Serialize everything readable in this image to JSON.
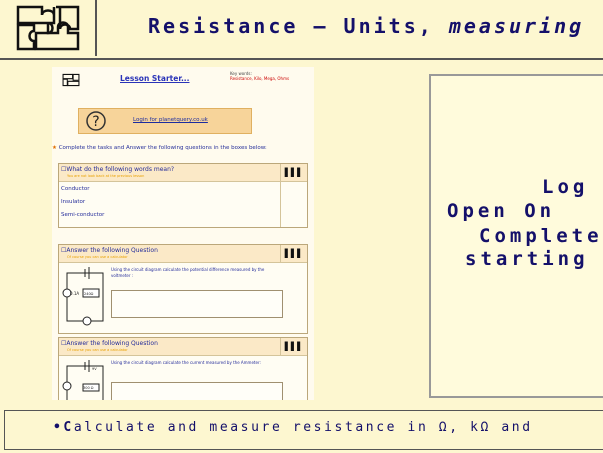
{
  "header": {
    "title_bold": "Resistance – Units, ",
    "title_italic": "measuring"
  },
  "worksheet": {
    "starter_link": "Lesson Starter...",
    "key_words_label": "Key words:",
    "key_words": "Resistance, Kilo, Mega, Ohms",
    "login_link": "Login for planetquery.co.uk",
    "instructions": "Complete the tasks and Answer the following questions in the boxes below:",
    "q1": {
      "title": "What do the following words mean?",
      "subtitle": "You are not look back at the previous lesson",
      "words": [
        "Conductor",
        "Insulator",
        "Semi-conductor"
      ]
    },
    "q2": {
      "title": "Answer the following Question",
      "subtitle": "Of course you can use a calculator",
      "text": "Using the circuit diagram calculate the potential difference measured by the voltmeter :",
      "labels": [
        "0.1A",
        "240Ω"
      ]
    },
    "q3": {
      "title": "Answer the following Question",
      "subtitle": "Of course you can use a calculator",
      "text": "Using the circuit diagram calculate the current measured by the Ammeter:",
      "labels": [
        "9V",
        "300 Ω"
      ]
    }
  },
  "right_panel": {
    "lines": [
      "Log",
      "Open On",
      "Complete",
      "starting"
    ]
  },
  "footer": {
    "objective_bold": "•C",
    "objective_rest": "alculate and measure resistance in Ω, kΩ and"
  },
  "colors": {
    "title": "#14106a",
    "background": "#fdf7d0",
    "link": "#2a33b8"
  }
}
